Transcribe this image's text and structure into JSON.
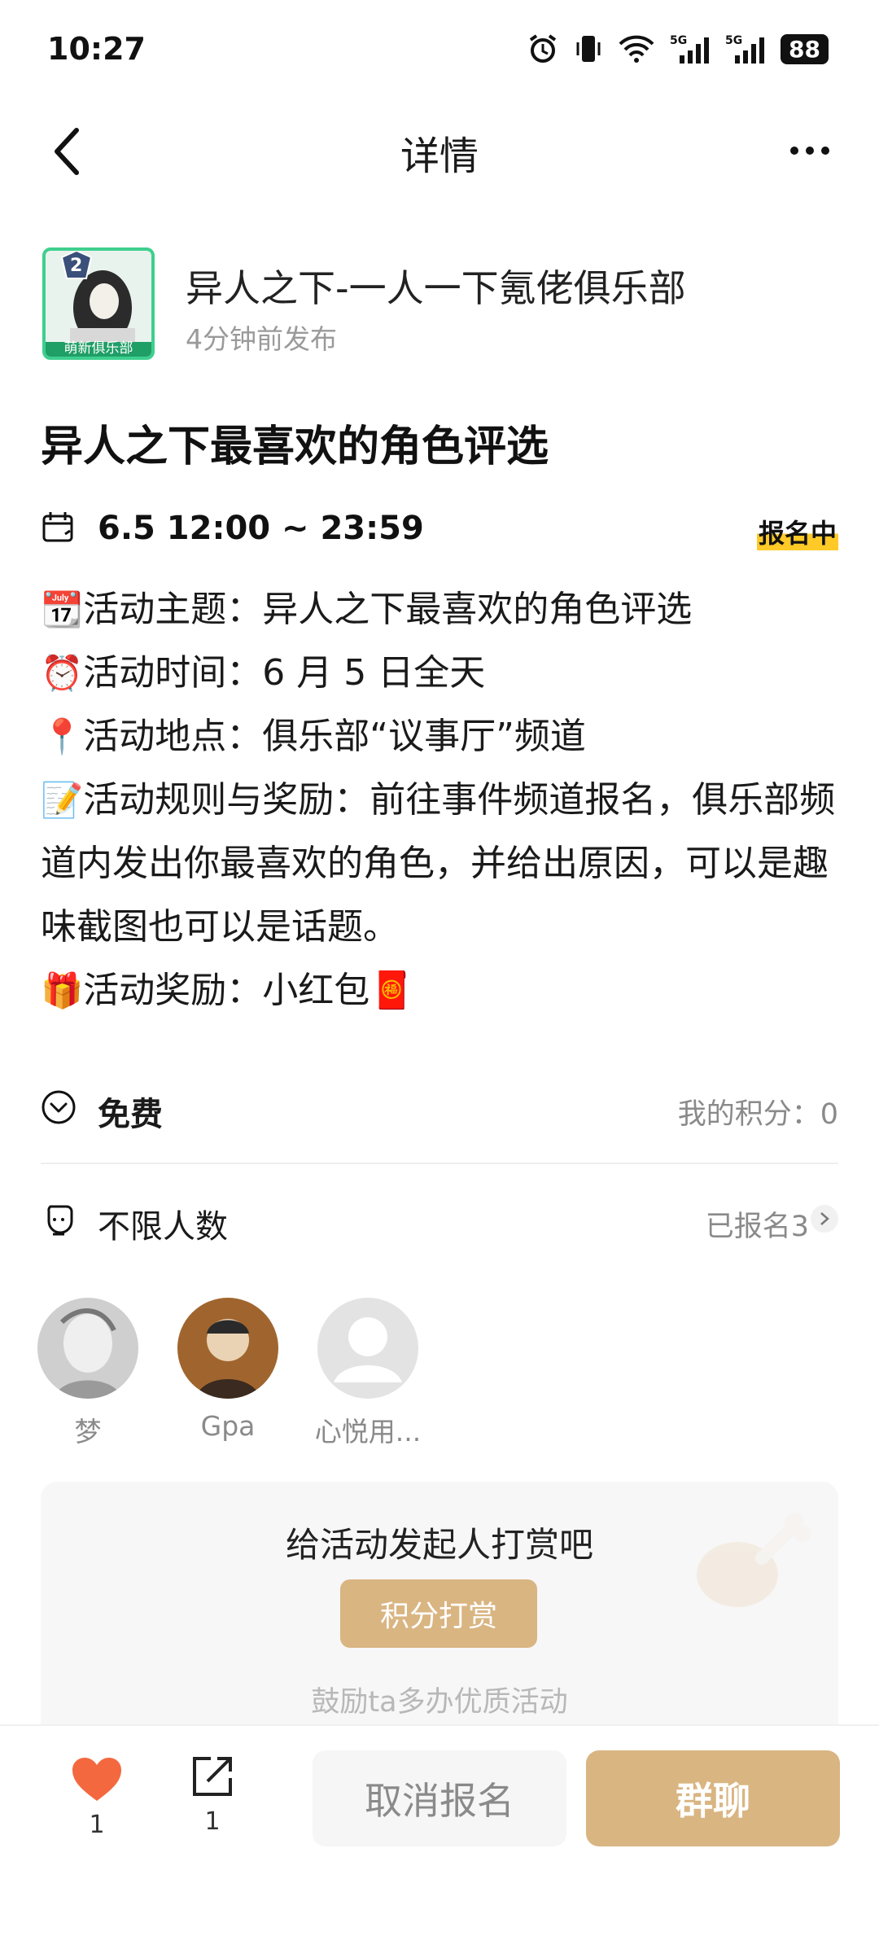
{
  "status_bar": {
    "time": "10:27",
    "battery": "88"
  },
  "nav": {
    "title": "详情"
  },
  "club": {
    "name": "异人之下-一人一下氪佬俱乐部",
    "posted": "4分钟前发布",
    "badge_text": "萌新俱乐部",
    "level": "2"
  },
  "event": {
    "title": "异人之下最喜欢的角色评选",
    "time": "6.5 12:00 ~ 23:59",
    "status": "报名中",
    "lines": [
      {
        "emoji": "📆",
        "text": "活动主题：异人之下最喜欢的角色评选"
      },
      {
        "emoji": "⏰",
        "text": "活动时间：6 月 5 日全天"
      },
      {
        "emoji": "📍",
        "text": "活动地点：俱乐部“议事厅”频道"
      },
      {
        "emoji": "📝",
        "text": "活动规则与奖励：前往事件频道报名，俱乐部频道内发出你最喜欢的角色，并给出原因，可以是趣味截图也可以是话题。"
      },
      {
        "emoji": "🎁",
        "text": "活动奖励：小红包🧧"
      }
    ]
  },
  "fee": {
    "label": "免费",
    "points": "我的积分：0"
  },
  "people": {
    "label": "不限人数",
    "signed": "已报名3"
  },
  "participants": [
    {
      "name": "梦"
    },
    {
      "name": "Gpa"
    },
    {
      "name": "心悦用..."
    }
  ],
  "tip": {
    "title": "给活动发起人打赏吧",
    "button": "积分打赏",
    "subtitle": "鼓励ta多办优质活动"
  },
  "bottom": {
    "likes": "1",
    "shares": "1",
    "cancel": "取消报名",
    "chat": "群聊"
  },
  "colors": {
    "accent": "#d9b582",
    "like": "#f4683f",
    "badge": "#ffc928"
  }
}
